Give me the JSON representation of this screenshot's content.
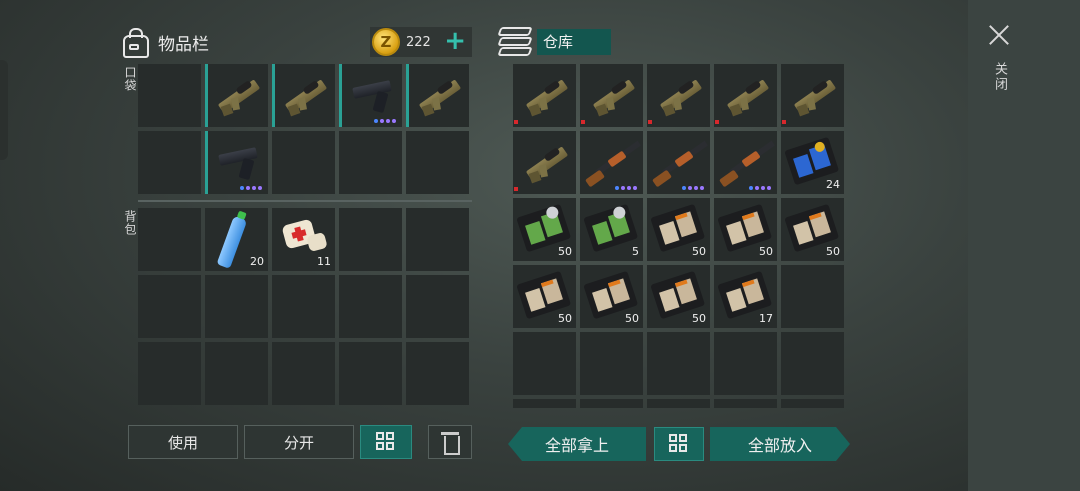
{
  "inventory": {
    "title": "物品栏",
    "coins": "222",
    "pocket_label": "口袋",
    "backpack_label": "背包",
    "pocket_items": [
      {
        "type": "empty"
      },
      {
        "type": "rifle"
      },
      {
        "type": "rifle"
      },
      {
        "type": "pistol"
      },
      {
        "type": "rifle"
      },
      {
        "type": "empty"
      },
      {
        "type": "pistol"
      },
      {
        "type": "empty"
      },
      {
        "type": "empty"
      },
      {
        "type": "empty"
      }
    ],
    "backpack_items": [
      {
        "type": "empty"
      },
      {
        "type": "bottle",
        "qty": "20"
      },
      {
        "type": "medkit",
        "qty": "11"
      }
    ]
  },
  "storage": {
    "title": "仓库",
    "items": [
      {
        "type": "rifle"
      },
      {
        "type": "rifle"
      },
      {
        "type": "rifle"
      },
      {
        "type": "rifle"
      },
      {
        "type": "rifle"
      },
      {
        "type": "rifle"
      },
      {
        "type": "shotgun"
      },
      {
        "type": "shotgun"
      },
      {
        "type": "shotgun"
      },
      {
        "type": "book-blue",
        "qty": "24"
      },
      {
        "type": "book-green",
        "qty": "50"
      },
      {
        "type": "book-green",
        "qty": "5"
      },
      {
        "type": "book-tan",
        "qty": "50"
      },
      {
        "type": "book-tan",
        "qty": "50"
      },
      {
        "type": "book-tan",
        "qty": "50"
      },
      {
        "type": "book-tan",
        "qty": "50"
      },
      {
        "type": "book-tan",
        "qty": "50"
      },
      {
        "type": "book-tan",
        "qty": "50"
      },
      {
        "type": "book-tan",
        "qty": "17"
      }
    ]
  },
  "buttons": {
    "use": "使用",
    "split": "分开",
    "take_all": "全部拿上",
    "put_all": "全部放入",
    "close": "关闭"
  },
  "icons": {
    "bag": "backpack-icon",
    "coin": "gold-coin-icon",
    "coin_glyph": "Z",
    "plus": "+",
    "storage": "storage-box-icon",
    "sort": "grid-sort-icon",
    "trash": "trash-icon",
    "close": "close-icon"
  },
  "colors": {
    "accent": "#17655c",
    "rarity_mark": "#2aa195",
    "coin": "#d9a012"
  }
}
